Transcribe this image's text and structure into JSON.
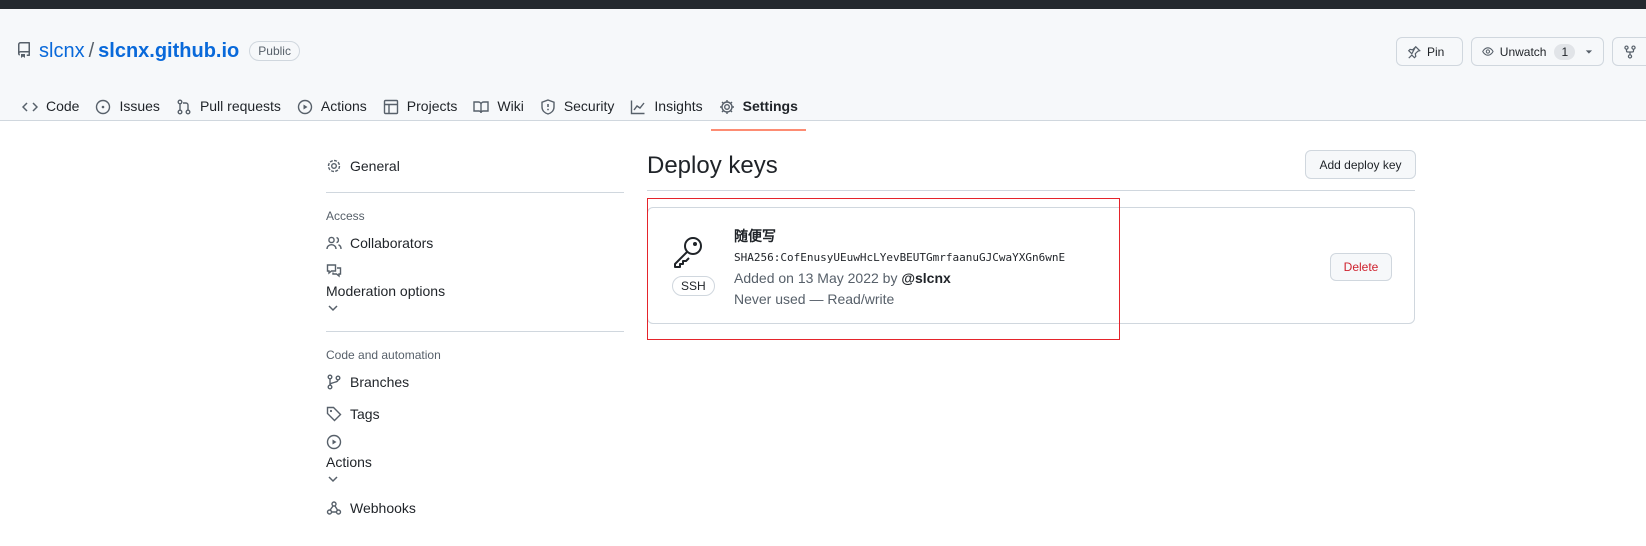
{
  "repo": {
    "owner": "slcnx",
    "separator": "/",
    "name": "slcnx.github.io",
    "visibility": "Public"
  },
  "header_actions": {
    "pin_label": "Pin",
    "watch_label": "Unwatch",
    "watch_count": "1"
  },
  "tabs": [
    {
      "label": "Code",
      "icon": "code-icon"
    },
    {
      "label": "Issues",
      "icon": "issue-icon"
    },
    {
      "label": "Pull requests",
      "icon": "pull-request-icon"
    },
    {
      "label": "Actions",
      "icon": "play-icon"
    },
    {
      "label": "Projects",
      "icon": "table-icon"
    },
    {
      "label": "Wiki",
      "icon": "book-icon"
    },
    {
      "label": "Security",
      "icon": "shield-icon"
    },
    {
      "label": "Insights",
      "icon": "graph-icon"
    },
    {
      "label": "Settings",
      "icon": "gear-icon",
      "active": true
    }
  ],
  "sidebar": {
    "general": "General",
    "access_heading": "Access",
    "collaborators": "Collaborators",
    "moderation": "Moderation options",
    "automation_heading": "Code and automation",
    "branches": "Branches",
    "tags": "Tags",
    "actions": "Actions",
    "webhooks": "Webhooks"
  },
  "main": {
    "title": "Deploy keys",
    "add_button": "Add deploy key",
    "key": {
      "title": "随便写",
      "fingerprint": "SHA256:CofEnusyUEuwHcLYevBEUTGmrfaanuGJCwaYXGn6wnE",
      "added_prefix": "Added on 13 May 2022 by",
      "added_user": "@slcnx",
      "usage": "Never used — Read/write",
      "type_badge": "SSH",
      "delete_label": "Delete"
    }
  },
  "colors": {
    "accent_link": "#0969da",
    "tab_underline": "#fd8c73",
    "danger": "#cf222e",
    "highlight_box": "#e5242b"
  }
}
